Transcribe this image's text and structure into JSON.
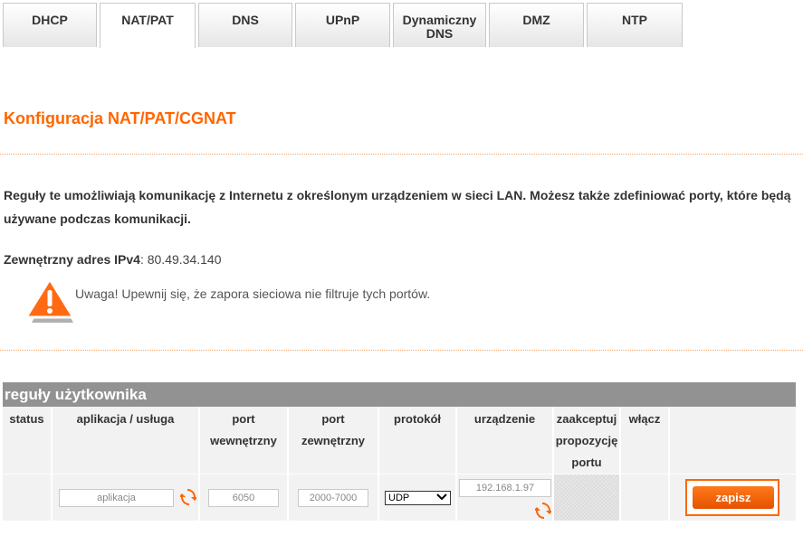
{
  "tabs": [
    {
      "label": "DHCP"
    },
    {
      "label": "NAT/PAT"
    },
    {
      "label": "DNS"
    },
    {
      "label": "UPnP"
    },
    {
      "label_line1": "Dynamiczny",
      "label_line2": "DNS"
    },
    {
      "label": "DMZ"
    },
    {
      "label": "NTP"
    }
  ],
  "page": {
    "title": "Konfiguracja NAT/PAT/CGNAT",
    "description": "Reguły te umożliwiają komunikację z Internetu z określonym urządzeniem w sieci LAN. Możesz także zdefiniować porty, które będą używane podczas komunikacji.",
    "ext_label": "Zewnętrzny adres IPv4",
    "ext_value": ": 80.49.34.140",
    "warning": "Uwaga! Upewnij się, że zapora sieciowa nie filtruje tych portów."
  },
  "table": {
    "title": "reguły użytkownika",
    "headers": {
      "status": "status",
      "app": "aplikacja / usługa",
      "port_int_1": "port",
      "port_int_2": "wewnętrzny",
      "port_ext_1": "port",
      "port_ext_2": "zewnętrzny",
      "protocol": "protokół",
      "device": "urządzenie",
      "accept_1": "zaakceptuj",
      "accept_2": "propozycję",
      "accept_3": "portu",
      "enable": "włącz"
    },
    "row": {
      "app_placeholder": "aplikacja",
      "port_int_placeholder": "6050",
      "port_ext_placeholder": "2000-7000",
      "protocol": "UDP",
      "device_placeholder": "192.168.1.97"
    },
    "save_label": "zapisz"
  },
  "colors": {
    "accent": "#ff6600",
    "table_header": "#929292"
  }
}
